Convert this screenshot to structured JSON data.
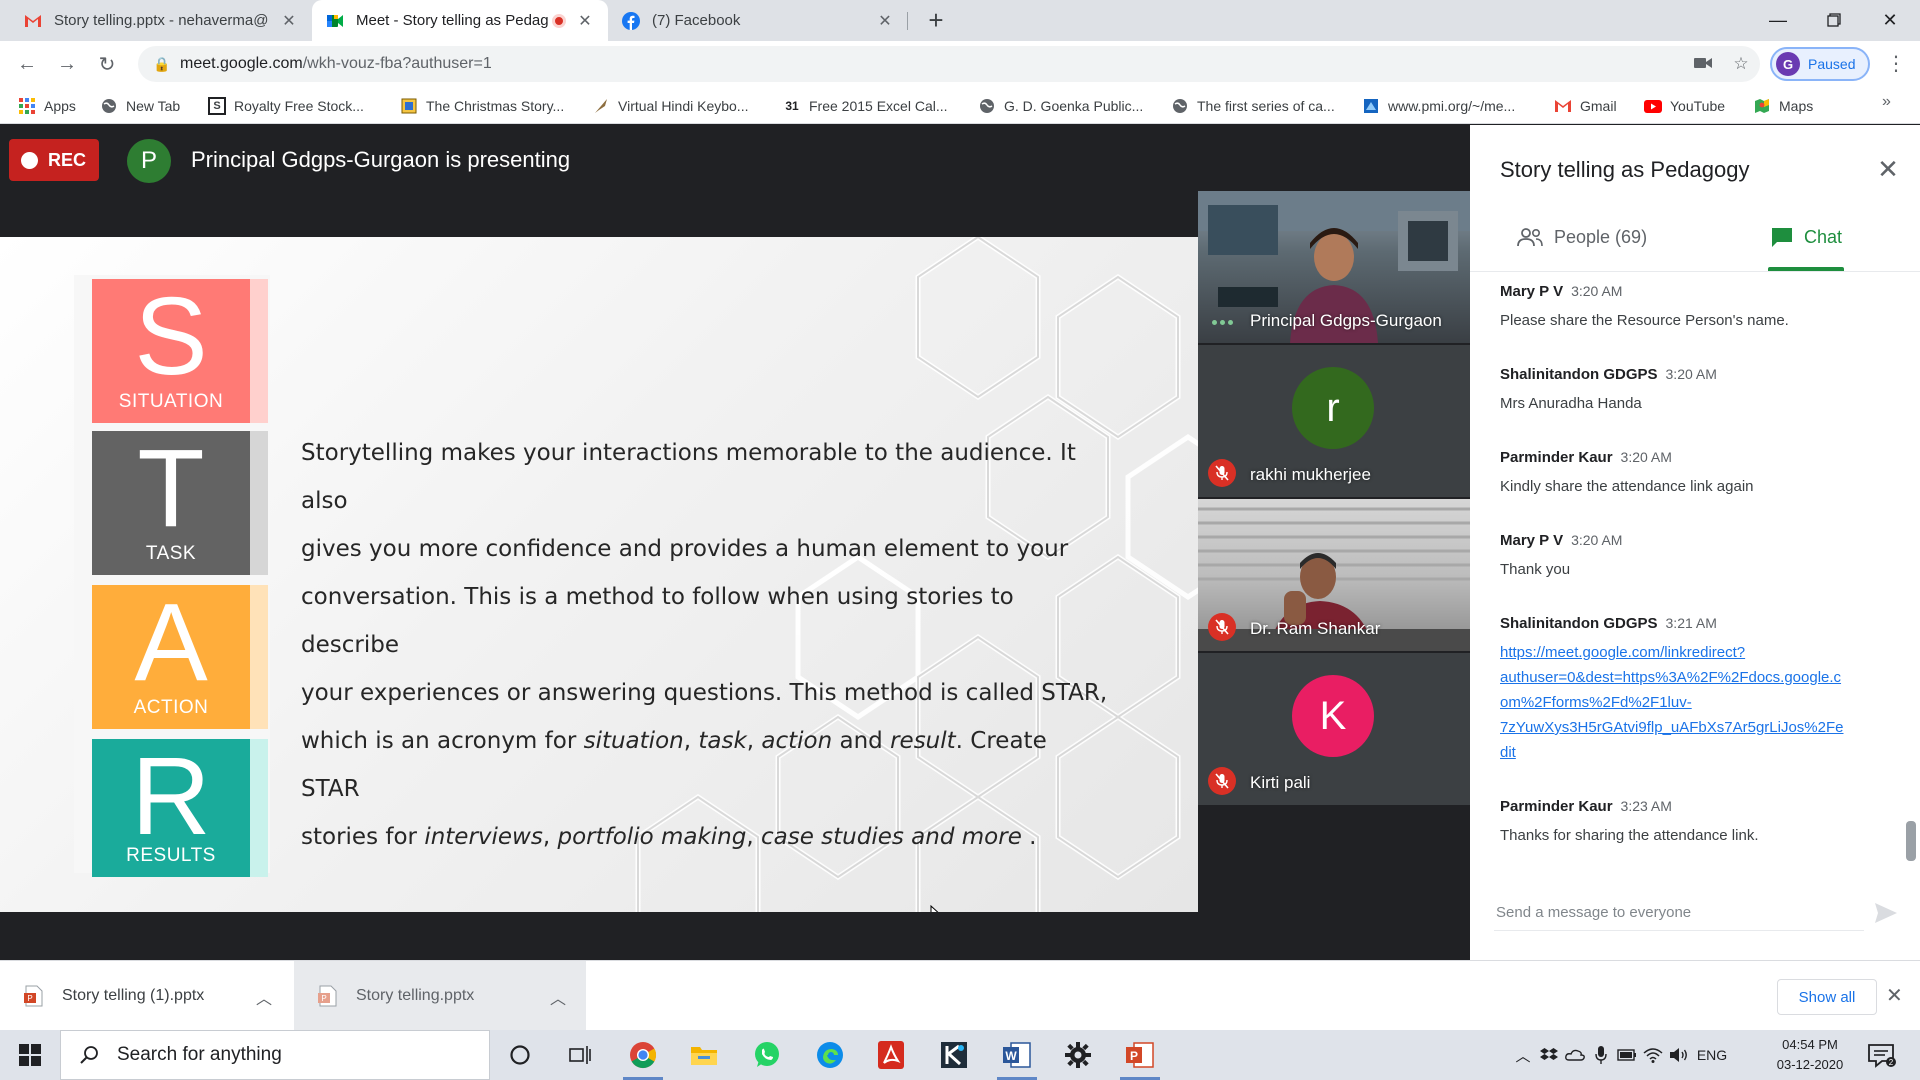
{
  "browser": {
    "tabs": [
      {
        "title": "Story telling.pptx - nehaverma@",
        "favicon": "gmail-icon"
      },
      {
        "title": "Meet - Story telling as Pedag",
        "favicon": "meet-icon",
        "recording": true
      },
      {
        "title": "(7) Facebook",
        "favicon": "facebook-icon"
      }
    ],
    "url_host": "meet.google.com",
    "url_path": "/wkh-vouz-fba?authuser=1",
    "profile_initial": "G",
    "profile_label": "Paused",
    "bookmarks": [
      {
        "label": "Apps",
        "icon": "apps-grid-icon"
      },
      {
        "label": "New Tab",
        "icon": "globe-icon"
      },
      {
        "label": "Royalty Free Stock...",
        "icon": "shutterstock-icon"
      },
      {
        "label": "The Christmas Story...",
        "icon": "page-icon"
      },
      {
        "label": "Virtual Hindi Keybo...",
        "icon": "quill-icon"
      },
      {
        "label": "Free 2015 Excel Cal...",
        "icon": "calendar-icon"
      },
      {
        "label": "G. D. Goenka Public...",
        "icon": "globe-icon"
      },
      {
        "label": "The first series of ca...",
        "icon": "globe-icon"
      },
      {
        "label": "www.pmi.org/~/me...",
        "icon": "pmi-icon"
      },
      {
        "label": "Gmail",
        "icon": "gmail-icon"
      },
      {
        "label": "YouTube",
        "icon": "youtube-icon"
      },
      {
        "label": "Maps",
        "icon": "maps-icon"
      }
    ]
  },
  "meet": {
    "rec_label": "REC",
    "presenter_initial": "P",
    "presenter_text": "Principal Gdgps-Gurgaon is presenting",
    "slide": {
      "letters": [
        {
          "letter": "S",
          "word": "SITUATION",
          "color": "#ff7a75",
          "stripe": "#ffd0cd"
        },
        {
          "letter": "T",
          "word": "TASK",
          "color": "#636363",
          "stripe": "#d6d6d6"
        },
        {
          "letter": "A",
          "word": "ACTION",
          "color": "#ffad3b",
          "stripe": "#ffe2b8"
        },
        {
          "letter": "R",
          "word": "RESULTS",
          "color": "#1aab9b",
          "stripe": "#c9f2ec"
        }
      ],
      "text_line1": "Storytelling makes your interactions memorable to the audience. It also",
      "text_line2": "gives you more confidence and provides a human element to your",
      "text_line3": "conversation. This is a method to follow when using stories to describe",
      "text_line4": "your experiences or answering questions. This method is called STAR,",
      "text_line5_a": "which is an acronym for ",
      "text_line5_i1": "situation",
      "text_line5_b": ", ",
      "text_line5_i2": "task",
      "text_line5_c": ", ",
      "text_line5_i3": "action",
      "text_line5_d": " and ",
      "text_line5_i4": "result",
      "text_line5_e": ". Create STAR",
      "text_line6_a": "stories for ",
      "text_line6_i1": "interviews",
      "text_line6_b": ", ",
      "text_line6_i2": "portfolio making",
      "text_line6_c": ", ",
      "text_line6_i3": "case studies and more",
      "text_line6_d": " ."
    },
    "participants": [
      {
        "name": "Principal Gdgps-Gurgaon",
        "type": "video",
        "speaking": true
      },
      {
        "name": "rakhi mukherjee",
        "type": "avatar",
        "initial": "r",
        "avatar_color": "#33691e",
        "muted": true
      },
      {
        "name": "Dr. Ram Shankar",
        "type": "video",
        "muted": true
      },
      {
        "name": "Kirti pali",
        "type": "avatar",
        "initial": "K",
        "avatar_color": "#e91e63",
        "muted": true
      }
    ]
  },
  "panel": {
    "title": "Story telling as Pedagogy",
    "people_tab": "People (69)",
    "chat_tab": "Chat",
    "messages": [
      {
        "sender": "Mary P V",
        "time": "3:20 AM",
        "text": "Please share the Resource Person's name."
      },
      {
        "sender": "Shalinitandon GDGPS",
        "time": "3:20 AM",
        "text": "Mrs Anuradha Handa"
      },
      {
        "sender": "Parminder Kaur",
        "time": "3:20 AM",
        "text": "Kindly share the attendance link again"
      },
      {
        "sender": "Mary P V",
        "time": "3:20 AM",
        "text": "Thank you"
      },
      {
        "sender": "Shalinitandon GDGPS",
        "time": "3:21 AM",
        "link_lines": [
          "https://meet.google.com/linkredirect?",
          "authuser=0&dest=https%3A%2F%2Fdocs.google.c",
          "om%2Fforms%2Fd%2F1luv-",
          "7zYuwXys3H5rGAtvi9flp_uAFbXs7Ar5grLiJos%2Fe",
          "dit"
        ]
      },
      {
        "sender": "Parminder Kaur",
        "time": "3:23 AM",
        "text": "Thanks for sharing the attendance link."
      }
    ],
    "composer_placeholder": "Send a message to everyone"
  },
  "downloads": {
    "items": [
      {
        "name": "Story telling (1).pptx"
      },
      {
        "name": "Story telling.pptx"
      }
    ],
    "show_all": "Show all"
  },
  "taskbar": {
    "search_placeholder": "Search for anything",
    "language": "ENG",
    "time": "04:54 PM",
    "date": "03-12-2020"
  }
}
